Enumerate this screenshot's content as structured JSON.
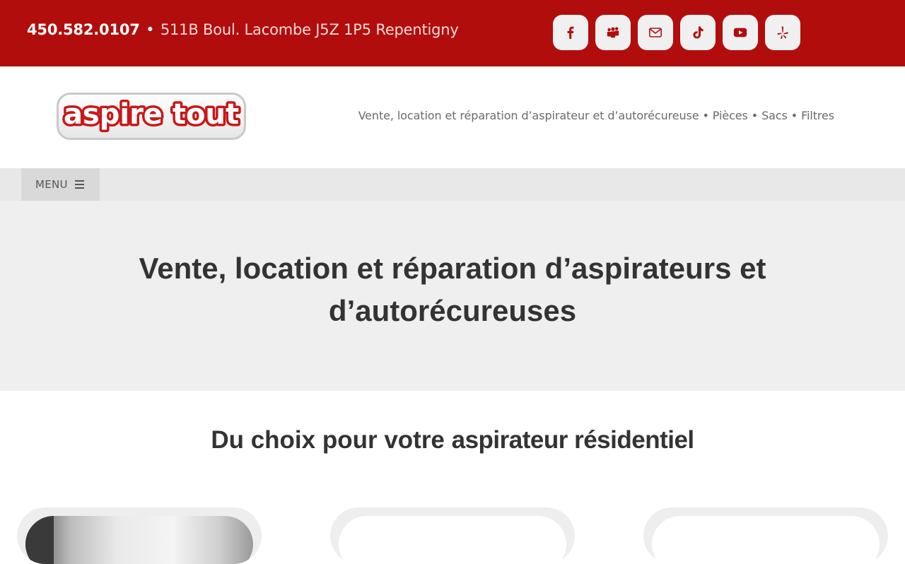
{
  "topbar": {
    "phone": "450.582.0107",
    "separator": "•",
    "address": "511B Boul. Lacombe J5Z 1P5 Repentigny",
    "socials": [
      {
        "icon": "facebook-icon"
      },
      {
        "icon": "myspace-icon"
      },
      {
        "icon": "mail-icon"
      },
      {
        "icon": "tiktok-icon"
      },
      {
        "icon": "youtube-icon"
      },
      {
        "icon": "yelp-icon"
      }
    ]
  },
  "header": {
    "logo_text": "aspire tout",
    "tagline": "Vente, location et réparation d’aspirateur et d’autorécureuse • Pièces • Sacs • Filtres"
  },
  "nav": {
    "menu_label": "MENU"
  },
  "hero": {
    "title": "Vente, location et réparation d’aspirateurs et d’autorécureuses"
  },
  "section": {
    "title_prefix": "Du choix pour votre ",
    "title_bold": "aspirateur résidentiel"
  },
  "colors": {
    "brand_red": "#b20d0d",
    "hero_bg": "#efefef",
    "menu_bg": "#e8e8e8",
    "text_dark": "#333333"
  }
}
